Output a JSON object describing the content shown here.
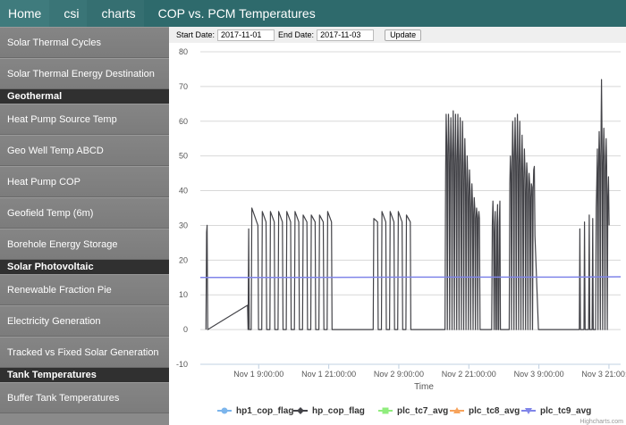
{
  "breadcrumb": [
    "Home",
    "csi",
    "charts",
    "COP vs. PCM Temperatures"
  ],
  "sidebar": [
    {
      "type": "item",
      "label": "Solar Thermal Cycles"
    },
    {
      "type": "item",
      "label": "Solar Thermal Energy Destination"
    },
    {
      "type": "header",
      "label": "Geothermal"
    },
    {
      "type": "item",
      "label": "Heat Pump Source Temp"
    },
    {
      "type": "item",
      "label": "Geo Well Temp ABCD"
    },
    {
      "type": "item",
      "label": "Heat Pump COP"
    },
    {
      "type": "item",
      "label": "Geofield Temp (6m)"
    },
    {
      "type": "item",
      "label": "Borehole Energy Storage"
    },
    {
      "type": "header",
      "label": "Solar Photovoltaic"
    },
    {
      "type": "item",
      "label": "Renewable Fraction Pie"
    },
    {
      "type": "item",
      "label": "Electricity Generation"
    },
    {
      "type": "item",
      "label": "Tracked vs Fixed Solar Generation"
    },
    {
      "type": "header",
      "label": "Tank Temperatures"
    },
    {
      "type": "item",
      "label": "Buffer Tank Temperatures"
    }
  ],
  "controls": {
    "start_label": "Start Date:",
    "start_value": "2017-11-01",
    "end_label": "End Date:",
    "end_value": "2017-11-03",
    "update_label": "Update"
  },
  "colors": {
    "hp1_cop_flag": "#7cb5ec",
    "hp_cop_flag": "#434348",
    "plc_tc7_avg": "#90ed7d",
    "plc_tc8_avg": "#f7a35c",
    "plc_tc9_avg": "#8085e9"
  },
  "chart_data": {
    "type": "line",
    "title": "",
    "xlabel": "Time",
    "ylabel": "",
    "ylim": [
      -10,
      80
    ],
    "yticks": [
      -10,
      0,
      10,
      20,
      30,
      40,
      50,
      60,
      70,
      80
    ],
    "xlim": [
      "2017-10-31 23:00",
      "2017-11-03 23:00"
    ],
    "xticks": [
      {
        "time": "2017-11-01 09:00",
        "label": "Nov 1 9:00:00"
      },
      {
        "time": "2017-11-01 21:00",
        "label": "Nov 1 21:00:00"
      },
      {
        "time": "2017-11-02 09:00",
        "label": "Nov 2 9:00:00"
      },
      {
        "time": "2017-11-02 21:00",
        "label": "Nov 2 21:00:00"
      },
      {
        "time": "2017-11-03 09:00",
        "label": "Nov 3 9:00:00"
      },
      {
        "time": "2017-11-03 21:00",
        "label": "Nov 3 21:00:00"
      }
    ],
    "legend_position": "bottom",
    "credit": "Highcharts.com",
    "series": [
      {
        "name": "hp1_cop_flag",
        "marker": "circle",
        "points": []
      },
      {
        "name": "hp_cop_flag",
        "marker": "diamond",
        "points": [
          [
            "2017-10-31 23:58",
            0
          ],
          [
            "2017-11-01 00:04",
            28
          ],
          [
            "2017-11-01 00:10",
            30
          ],
          [
            "2017-11-01 00:16",
            0
          ],
          [
            "2017-11-01 07:05",
            7
          ],
          [
            "2017-11-01 07:11",
            0
          ],
          [
            "2017-11-01 07:17",
            29
          ],
          [
            "2017-11-01 07:23",
            0
          ],
          [
            "2017-11-01 07:43",
            0
          ],
          [
            "2017-11-01 07:49",
            35
          ],
          [
            "2017-11-01 08:02",
            34
          ],
          [
            "2017-11-01 08:52",
            30
          ],
          [
            "2017-11-01 08:58",
            0
          ],
          [
            "2017-11-01 09:31",
            0
          ],
          [
            "2017-11-01 09:37",
            34
          ],
          [
            "2017-11-01 10:16",
            31
          ],
          [
            "2017-11-01 10:22",
            0
          ],
          [
            "2017-11-01 10:55",
            0
          ],
          [
            "2017-11-01 11:01",
            34
          ],
          [
            "2017-11-01 11:40",
            31
          ],
          [
            "2017-11-01 11:46",
            0
          ],
          [
            "2017-11-01 12:19",
            0
          ],
          [
            "2017-11-01 12:25",
            34
          ],
          [
            "2017-11-01 13:04",
            31
          ],
          [
            "2017-11-01 13:10",
            0
          ],
          [
            "2017-11-01 13:43",
            0
          ],
          [
            "2017-11-01 13:49",
            34
          ],
          [
            "2017-11-01 14:28",
            31
          ],
          [
            "2017-11-01 14:34",
            0
          ],
          [
            "2017-11-01 15:07",
            0
          ],
          [
            "2017-11-01 15:13",
            34
          ],
          [
            "2017-11-01 15:52",
            31
          ],
          [
            "2017-11-01 15:58",
            0
          ],
          [
            "2017-11-01 16:31",
            0
          ],
          [
            "2017-11-01 16:37",
            33
          ],
          [
            "2017-11-01 17:16",
            31
          ],
          [
            "2017-11-01 17:22",
            0
          ],
          [
            "2017-11-01 17:55",
            0
          ],
          [
            "2017-11-01 18:01",
            33
          ],
          [
            "2017-11-01 18:40",
            31
          ],
          [
            "2017-11-01 18:46",
            0
          ],
          [
            "2017-11-01 19:19",
            0
          ],
          [
            "2017-11-01 19:25",
            33
          ],
          [
            "2017-11-01 20:04",
            31
          ],
          [
            "2017-11-01 20:10",
            0
          ],
          [
            "2017-11-01 20:43",
            0
          ],
          [
            "2017-11-01 20:49",
            34
          ],
          [
            "2017-11-01 21:28",
            31
          ],
          [
            "2017-11-01 21:34",
            0
          ],
          [
            "2017-11-02 04:37",
            0
          ],
          [
            "2017-11-02 04:43",
            32
          ],
          [
            "2017-11-02 05:22",
            31
          ],
          [
            "2017-11-02 05:28",
            0
          ],
          [
            "2017-11-02 06:01",
            0
          ],
          [
            "2017-11-02 06:07",
            34
          ],
          [
            "2017-11-02 06:46",
            31
          ],
          [
            "2017-11-02 06:52",
            0
          ],
          [
            "2017-11-02 07:25",
            0
          ],
          [
            "2017-11-02 07:31",
            34
          ],
          [
            "2017-11-02 08:10",
            31
          ],
          [
            "2017-11-02 08:16",
            0
          ],
          [
            "2017-11-02 08:49",
            0
          ],
          [
            "2017-11-02 08:55",
            34
          ],
          [
            "2017-11-02 09:34",
            31
          ],
          [
            "2017-11-02 09:40",
            0
          ],
          [
            "2017-11-02 10:13",
            0
          ],
          [
            "2017-11-02 10:19",
            33
          ],
          [
            "2017-11-02 10:58",
            31
          ],
          [
            "2017-11-02 11:04",
            0
          ],
          [
            "2017-11-02 16:55",
            0
          ],
          [
            "2017-11-02 17:01",
            45
          ],
          [
            "2017-11-02 17:07",
            62
          ],
          [
            "2017-11-02 17:13",
            53
          ],
          [
            "2017-11-02 17:19",
            0
          ],
          [
            "2017-11-02 17:25",
            50
          ],
          [
            "2017-11-02 17:31",
            62
          ],
          [
            "2017-11-02 17:37",
            52
          ],
          [
            "2017-11-02 17:43",
            0
          ],
          [
            "2017-11-02 17:49",
            48
          ],
          [
            "2017-11-02 17:55",
            61
          ],
          [
            "2017-11-02 18:01",
            51
          ],
          [
            "2017-11-02 18:07",
            0
          ],
          [
            "2017-11-02 18:13",
            49
          ],
          [
            "2017-11-02 18:19",
            63
          ],
          [
            "2017-11-02 18:25",
            50
          ],
          [
            "2017-11-02 18:31",
            0
          ],
          [
            "2017-11-02 18:37",
            47
          ],
          [
            "2017-11-02 18:43",
            62
          ],
          [
            "2017-11-02 18:49",
            49
          ],
          [
            "2017-11-02 18:55",
            0
          ],
          [
            "2017-11-02 19:01",
            48
          ],
          [
            "2017-11-02 19:07",
            62
          ],
          [
            "2017-11-02 19:13",
            50
          ],
          [
            "2017-11-02 19:19",
            0
          ],
          [
            "2017-11-02 19:25",
            47
          ],
          [
            "2017-11-02 19:31",
            61
          ],
          [
            "2017-11-02 19:37",
            49
          ],
          [
            "2017-11-02 19:43",
            0
          ],
          [
            "2017-11-02 19:49",
            45
          ],
          [
            "2017-11-02 19:55",
            60
          ],
          [
            "2017-11-02 20:01",
            48
          ],
          [
            "2017-11-02 20:07",
            0
          ],
          [
            "2017-11-02 20:13",
            43
          ],
          [
            "2017-11-02 20:19",
            55
          ],
          [
            "2017-11-02 20:25",
            46
          ],
          [
            "2017-11-02 20:31",
            0
          ],
          [
            "2017-11-02 20:37",
            40
          ],
          [
            "2017-11-02 20:43",
            50
          ],
          [
            "2017-11-02 20:49",
            42
          ],
          [
            "2017-11-02 20:55",
            0
          ],
          [
            "2017-11-02 21:01",
            38
          ],
          [
            "2017-11-02 21:07",
            46
          ],
          [
            "2017-11-02 21:13",
            40
          ],
          [
            "2017-11-02 21:19",
            0
          ],
          [
            "2017-11-02 21:25",
            35
          ],
          [
            "2017-11-02 21:31",
            42
          ],
          [
            "2017-11-02 21:37",
            37
          ],
          [
            "2017-11-02 21:43",
            0
          ],
          [
            "2017-11-02 21:49",
            33
          ],
          [
            "2017-11-02 21:55",
            38
          ],
          [
            "2017-11-02 22:01",
            35
          ],
          [
            "2017-11-02 22:07",
            0
          ],
          [
            "2017-11-02 22:13",
            32
          ],
          [
            "2017-11-02 22:19",
            35
          ],
          [
            "2017-11-02 22:25",
            33
          ],
          [
            "2017-11-02 22:31",
            0
          ],
          [
            "2017-11-02 22:37",
            32
          ],
          [
            "2017-11-02 22:43",
            34
          ],
          [
            "2017-11-02 22:49",
            32
          ],
          [
            "2017-11-02 22:55",
            0
          ],
          [
            "2017-11-03 00:55",
            0
          ],
          [
            "2017-11-03 01:01",
            30
          ],
          [
            "2017-11-03 01:07",
            37
          ],
          [
            "2017-11-03 01:13",
            31
          ],
          [
            "2017-11-03 01:19",
            0
          ],
          [
            "2017-11-03 01:25",
            28
          ],
          [
            "2017-11-03 01:31",
            34
          ],
          [
            "2017-11-03 01:37",
            0
          ],
          [
            "2017-11-03 01:43",
            0
          ],
          [
            "2017-11-03 01:49",
            30
          ],
          [
            "2017-11-03 01:55",
            36
          ],
          [
            "2017-11-03 02:01",
            0
          ],
          [
            "2017-11-03 02:07",
            0
          ],
          [
            "2017-11-03 02:13",
            31
          ],
          [
            "2017-11-03 02:19",
            37
          ],
          [
            "2017-11-03 02:25",
            0
          ],
          [
            "2017-11-03 03:55",
            0
          ],
          [
            "2017-11-03 04:01",
            42
          ],
          [
            "2017-11-03 04:07",
            50
          ],
          [
            "2017-11-03 04:13",
            45
          ],
          [
            "2017-11-03 04:19",
            0
          ],
          [
            "2017-11-03 04:25",
            48
          ],
          [
            "2017-11-03 04:31",
            60
          ],
          [
            "2017-11-03 04:37",
            50
          ],
          [
            "2017-11-03 04:43",
            0
          ],
          [
            "2017-11-03 04:49",
            49
          ],
          [
            "2017-11-03 04:55",
            61
          ],
          [
            "2017-11-03 05:01",
            50
          ],
          [
            "2017-11-03 05:07",
            0
          ],
          [
            "2017-11-03 05:13",
            48
          ],
          [
            "2017-11-03 05:19",
            62
          ],
          [
            "2017-11-03 05:25",
            49
          ],
          [
            "2017-11-03 05:31",
            0
          ],
          [
            "2017-11-03 05:37",
            47
          ],
          [
            "2017-11-03 05:43",
            60
          ],
          [
            "2017-11-03 05:49",
            48
          ],
          [
            "2017-11-03 05:55",
            0
          ],
          [
            "2017-11-03 06:01",
            45
          ],
          [
            "2017-11-03 06:07",
            56
          ],
          [
            "2017-11-03 06:13",
            46
          ],
          [
            "2017-11-03 06:19",
            0
          ],
          [
            "2017-11-03 06:25",
            43
          ],
          [
            "2017-11-03 06:31",
            52
          ],
          [
            "2017-11-03 06:37",
            45
          ],
          [
            "2017-11-03 06:43",
            0
          ],
          [
            "2017-11-03 06:49",
            40
          ],
          [
            "2017-11-03 06:55",
            48
          ],
          [
            "2017-11-03 07:01",
            44
          ],
          [
            "2017-11-03 07:07",
            0
          ],
          [
            "2017-11-03 07:13",
            39
          ],
          [
            "2017-11-03 07:19",
            45
          ],
          [
            "2017-11-03 07:25",
            42
          ],
          [
            "2017-11-03 07:31",
            0
          ],
          [
            "2017-11-03 07:37",
            38
          ],
          [
            "2017-11-03 07:43",
            42
          ],
          [
            "2017-11-03 07:49",
            41
          ],
          [
            "2017-11-03 07:55",
            0
          ],
          [
            "2017-11-03 08:01",
            40
          ],
          [
            "2017-11-03 08:07",
            46
          ],
          [
            "2017-11-03 08:13",
            47
          ],
          [
            "2017-11-03 08:19",
            27
          ],
          [
            "2017-11-03 08:55",
            0
          ],
          [
            "2017-11-03 15:55",
            0
          ],
          [
            "2017-11-03 16:01",
            29
          ],
          [
            "2017-11-03 16:07",
            0
          ],
          [
            "2017-11-03 16:43",
            0
          ],
          [
            "2017-11-03 16:49",
            31
          ],
          [
            "2017-11-03 16:55",
            0
          ],
          [
            "2017-11-03 17:31",
            0
          ],
          [
            "2017-11-03 17:37",
            33
          ],
          [
            "2017-11-03 17:43",
            0
          ],
          [
            "2017-11-03 18:07",
            0
          ],
          [
            "2017-11-03 18:13",
            32
          ],
          [
            "2017-11-03 18:19",
            0
          ],
          [
            "2017-11-03 18:43",
            0
          ],
          [
            "2017-11-03 18:49",
            35
          ],
          [
            "2017-11-03 18:55",
            42
          ],
          [
            "2017-11-03 19:01",
            52
          ],
          [
            "2017-11-03 19:07",
            0
          ],
          [
            "2017-11-03 19:13",
            45
          ],
          [
            "2017-11-03 19:19",
            57
          ],
          [
            "2017-11-03 19:25",
            50
          ],
          [
            "2017-11-03 19:31",
            0
          ],
          [
            "2017-11-03 19:37",
            50
          ],
          [
            "2017-11-03 19:43",
            72
          ],
          [
            "2017-11-03 19:49",
            55
          ],
          [
            "2017-11-03 19:55",
            0
          ],
          [
            "2017-11-03 20:01",
            48
          ],
          [
            "2017-11-03 20:07",
            58
          ],
          [
            "2017-11-03 20:13",
            50
          ],
          [
            "2017-11-03 20:19",
            0
          ],
          [
            "2017-11-03 20:25",
            45
          ],
          [
            "2017-11-03 20:31",
            55
          ],
          [
            "2017-11-03 20:37",
            47
          ],
          [
            "2017-11-03 20:43",
            0
          ],
          [
            "2017-11-03 20:49",
            38
          ],
          [
            "2017-11-03 20:55",
            44
          ],
          [
            "2017-11-03 21:01",
            30
          ]
        ]
      },
      {
        "name": "plc_tc7_avg",
        "marker": "square",
        "points": []
      },
      {
        "name": "plc_tc8_avg",
        "marker": "triangle",
        "points": []
      },
      {
        "name": "plc_tc9_avg",
        "marker": "triangle-down",
        "points": [
          [
            "2017-10-31 23:00",
            15.0
          ],
          [
            "2017-11-01 12:00",
            15.0
          ],
          [
            "2017-11-02 12:00",
            15.1
          ],
          [
            "2017-11-03 12:00",
            15.1
          ],
          [
            "2017-11-03 23:00",
            15.2
          ]
        ]
      }
    ]
  }
}
